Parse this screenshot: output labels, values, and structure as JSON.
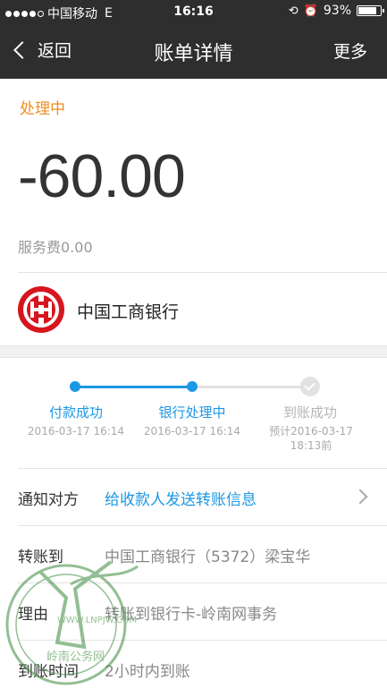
{
  "status_bar": {
    "carrier": "中国移动",
    "network": "E",
    "time": "16:16",
    "battery": "93%",
    "battery_level": 0.93
  },
  "navbar": {
    "back_label": "返回",
    "title": "账单详情",
    "more_label": "更多"
  },
  "bill": {
    "status": "处理中",
    "amount": "-60.00",
    "fee": "服务费0.00",
    "bank_name": "中国工商银行"
  },
  "progress": {
    "steps": [
      {
        "label": "付款成功",
        "date": "2016-03-17 16:14"
      },
      {
        "label": "银行处理中",
        "date": "2016-03-17 16:14"
      },
      {
        "label": "到账成功",
        "date_line1": "预计2016-03-17",
        "date_line2": "18:13前"
      }
    ]
  },
  "details": {
    "notify_label": "通知对方",
    "notify_value": "给收款人发送转账信息",
    "transfer_label": "转账到",
    "transfer_value": "中国工商银行（5372）梁宝华",
    "reason_label": "理由",
    "reason_value": "转账到银行卡-岭南网事务",
    "arrival_label": "到账时间",
    "arrival_value": "2小时内到账"
  },
  "watermark": {
    "url": "WWW.LNPJW.COM",
    "name": "岭南公务网"
  },
  "colors": {
    "accent": "#1d98e4",
    "status_orange": "#f28c1c",
    "bank_red": "#d6161e",
    "navbar": "#2e2e2e"
  }
}
